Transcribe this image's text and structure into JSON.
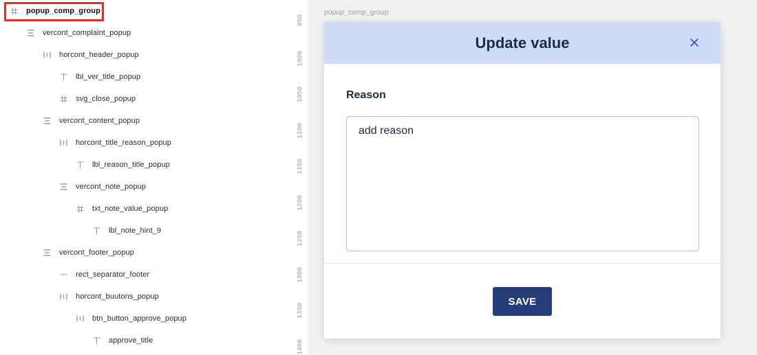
{
  "layers": [
    {
      "label": "popup_comp_group",
      "icon": "frame-hash-icon",
      "selected": true
    },
    {
      "label": "vercont_complaint_popup",
      "icon": "vertical-stack-icon"
    },
    {
      "label": "horcont_header_popup",
      "icon": "horizontal-stack-icon"
    },
    {
      "label": "lbl_ver_title_popup",
      "icon": "text-icon"
    },
    {
      "label": "svg_close_popup",
      "icon": "frame-hash-icon"
    },
    {
      "label": "vercont_content_popup",
      "icon": "vertical-stack-icon"
    },
    {
      "label": "horcont_title_reason_popup",
      "icon": "horizontal-stack-icon"
    },
    {
      "label": "lbl_reason_title_popup",
      "icon": "text-icon"
    },
    {
      "label": "vercont_note_popup",
      "icon": "vertical-stack-icon"
    },
    {
      "label": "txt_note_value_popup",
      "icon": "frame-hash-icon"
    },
    {
      "label": "lbl_note_hint_9",
      "icon": "text-icon"
    },
    {
      "label": "vercont_footer_popup",
      "icon": "vertical-stack-icon"
    },
    {
      "label": "rect_separator_footer",
      "icon": "line-icon"
    },
    {
      "label": "horcont_buutons_popup",
      "icon": "horizontal-stack-icon"
    },
    {
      "label": "btn_button_approve_popup",
      "icon": "horizontal-stack-icon"
    },
    {
      "label": "approve_title",
      "icon": "text-icon"
    }
  ],
  "ruler": {
    "ticks": [
      "950",
      "1000",
      "1050",
      "1100",
      "1150",
      "1200",
      "1250",
      "1300",
      "1350",
      "1400"
    ]
  },
  "canvas": {
    "frame_label": "popup_comp_group",
    "popup": {
      "title": "Update value",
      "close_icon": "close-icon",
      "reason_title": "Reason",
      "note_value": "add reason",
      "save_label": "SAVE"
    }
  },
  "colors": {
    "header_bg": "#cfdcf7",
    "title_text": "#1b2b4b",
    "save_button": "#253d78",
    "selection": "#e0322b"
  }
}
